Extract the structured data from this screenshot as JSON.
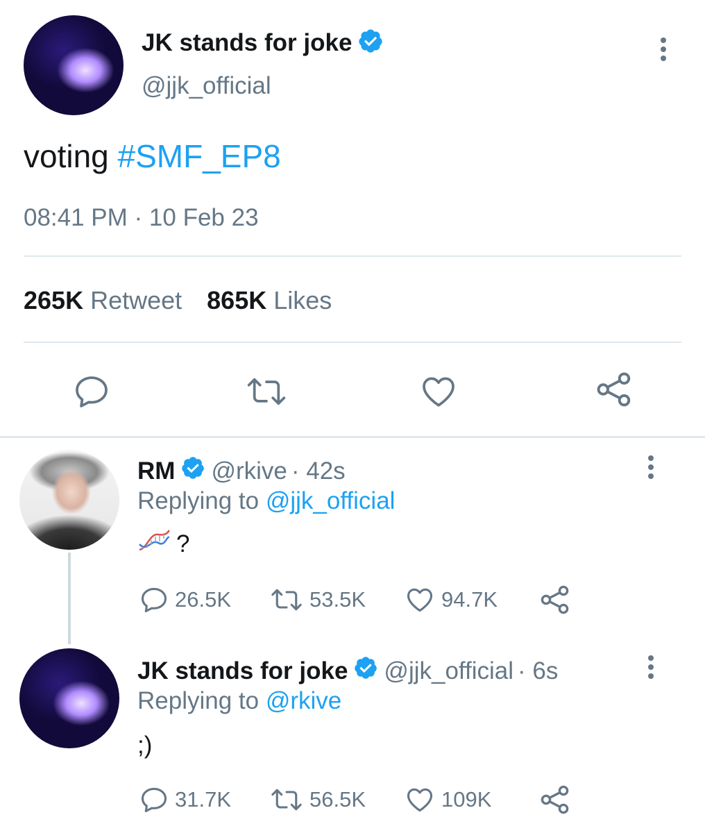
{
  "main_tweet": {
    "display_name": "JK stands for joke",
    "handle": "@jjk_official",
    "text_plain": "voting ",
    "hashtag": "#SMF_EP8",
    "timestamp": "08:41 PM · 10 Feb 23",
    "retweet_count": "265K",
    "retweet_label": "Retweet",
    "like_count": "865K",
    "like_label": "Likes"
  },
  "replies": [
    {
      "display_name": "RM",
      "handle": "@rkive",
      "time": "· 42s",
      "replying_prefix": "Replying to ",
      "replying_to": "@jjk_official",
      "text": "?",
      "emoji": "dna-emoji",
      "reply_count": "26.5K",
      "retweet_count": "53.5K",
      "like_count": "94.7K"
    },
    {
      "display_name": "JK stands for joke",
      "handle": "@jjk_official",
      "time": "· 6s",
      "replying_prefix": "Replying to ",
      "replying_to": "@rkive",
      "text": ";)",
      "reply_count": "31.7K",
      "retweet_count": "56.5K",
      "like_count": "109K"
    }
  ],
  "colors": {
    "accent": "#1da1f2",
    "muted": "#657786",
    "text": "#14171a",
    "divider": "#e1e8ed"
  }
}
